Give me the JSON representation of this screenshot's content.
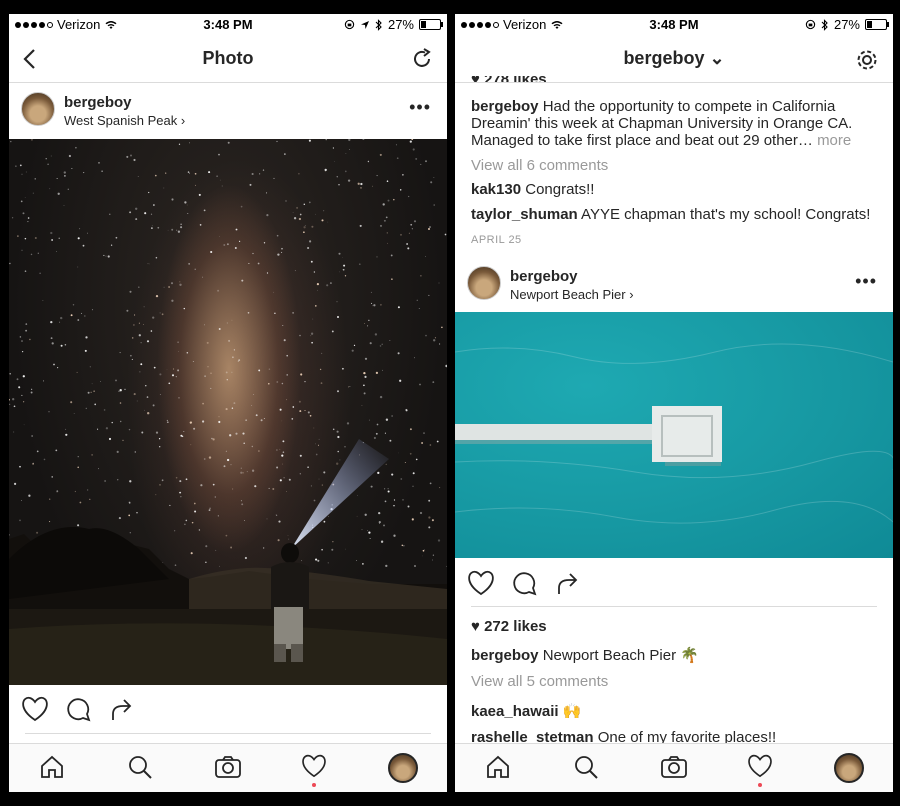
{
  "left": {
    "status": {
      "carrier": "Verizon",
      "time": "3:48 PM",
      "battery": "27%",
      "battery_level": 0.27
    },
    "nav": {
      "title": "Photo"
    },
    "post": {
      "username": "bergeboy",
      "location": "West Spanish Peak ›"
    },
    "tabs": [
      "home-icon",
      "search-icon",
      "camera-icon",
      "heart-icon",
      "profile-avatar"
    ]
  },
  "right": {
    "status": {
      "carrier": "Verizon",
      "time": "3:48 PM",
      "battery": "27%",
      "battery_level": 0.27
    },
    "nav": {
      "title": "bergeboy ⌄"
    },
    "prev_post": {
      "likes_partial": "♥ 278 likes",
      "caption_user": "bergeboy",
      "caption_text": "Had the opportunity to compete in California Dreamin' this week at Chapman University in Orange CA. Managed to take first place and beat out 29 other…",
      "more": "more",
      "view_all": "View all 6 comments",
      "comments": [
        {
          "user": "kak130",
          "text": "Congrats!!"
        },
        {
          "user": "taylor_shuman",
          "text": "AYYE chapman that's my school! Congrats!"
        }
      ],
      "date": "APRIL 25"
    },
    "post": {
      "username": "bergeboy",
      "location": "Newport Beach Pier ›",
      "likes": "272 likes",
      "caption_user": "bergeboy",
      "caption_text": "Newport Beach Pier 🌴",
      "view_all": "View all 5 comments",
      "comments": [
        {
          "user": "kaea_hawaii",
          "text": "🙌"
        },
        {
          "user": "rashelle_stetman",
          "text": "One of my favorite places!!"
        }
      ]
    },
    "tabs": [
      "home-icon",
      "search-icon",
      "camera-icon",
      "heart-icon",
      "profile-avatar"
    ]
  }
}
